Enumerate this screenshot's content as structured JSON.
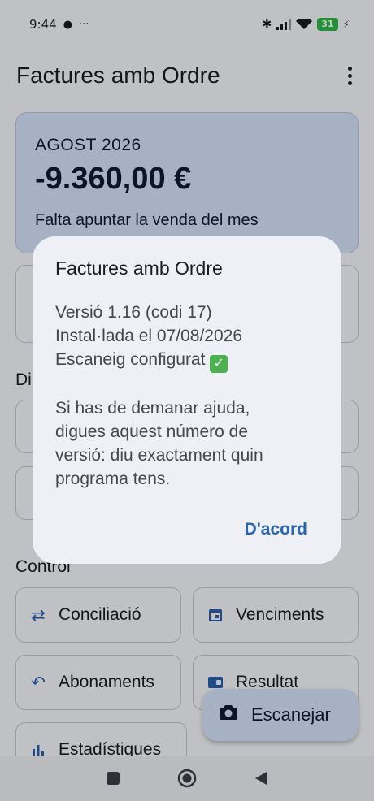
{
  "status_bar": {
    "time": "9:44",
    "battery": "31"
  },
  "app_bar": {
    "title": "Factures amb Ordre"
  },
  "summary": {
    "period": "AGOST 2026",
    "amount": "-9.360,00 €",
    "note": "Falta apuntar la venda del mes"
  },
  "background": {
    "section_di": "Di",
    "section_control": "Control",
    "tiles": [
      {
        "label": "Conciliació",
        "icon": "swap-icon"
      },
      {
        "label": "Venciments",
        "icon": "calendar-icon"
      },
      {
        "label": "Abonaments",
        "icon": "undo-icon"
      },
      {
        "label": "Resultat",
        "icon": "wallet-icon"
      },
      {
        "label": "Estadístiques",
        "icon": "bar-chart-icon"
      }
    ]
  },
  "fab": {
    "label": "Escanejar",
    "icon": "camera-icon"
  },
  "dialog": {
    "title": "Factures amb Ordre",
    "line1": "Versió 1.16 (codi 17)",
    "line2": "Instal·lada el 07/08/2026",
    "line3": "Escaneig configurat",
    "help1": "Si has de demanar ajuda,",
    "help2": "digues aquest número de",
    "help3": "versió: diu exactament quin",
    "help4": "programa tens.",
    "ok_label": "D'acord"
  }
}
